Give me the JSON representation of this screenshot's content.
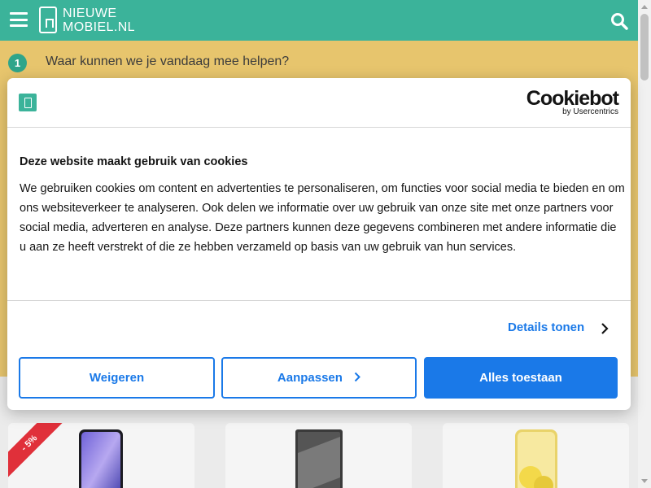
{
  "header": {
    "logo_line1": "NIEUWE",
    "logo_line2": "MOBIEL.NL",
    "icons": [
      "hamburger-icon",
      "phone-logo-icon",
      "search-icon"
    ],
    "colors": {
      "header_bg": "#3bb39a",
      "icon": "#ffffff"
    }
  },
  "step": {
    "number": "1",
    "text": "Waar kunnen we je vandaag mee helpen?",
    "colors": {
      "section_bg": "#e7c56d",
      "badge_bg": "#2fa58a"
    }
  },
  "cookie_dialog": {
    "brand": "Cookiebot",
    "brand_sub": "by Usercentrics",
    "title": "Deze website maakt gebruik van cookies",
    "body": "We gebruiken cookies om content en advertenties te personaliseren, om functies voor social media te bieden en om ons websiteverkeer te analyseren. Ook delen we informatie over uw gebruik van onze site met onze partners voor social media, adverteren en analyse. Deze partners kunnen deze gegevens combineren met andere informatie die u aan ze heeft verstrekt of die ze hebben verzameld op basis van uw gebruik van hun services.",
    "details_label": "Details tonen",
    "buttons": {
      "decline": "Weigeren",
      "customize": "Aanpassen",
      "accept_all": "Alles toestaan"
    },
    "colors": {
      "accent": "#1a79e8"
    }
  },
  "products": {
    "discount_badge": "- 5%",
    "colors": {
      "ribbon": "#e0303a"
    }
  }
}
